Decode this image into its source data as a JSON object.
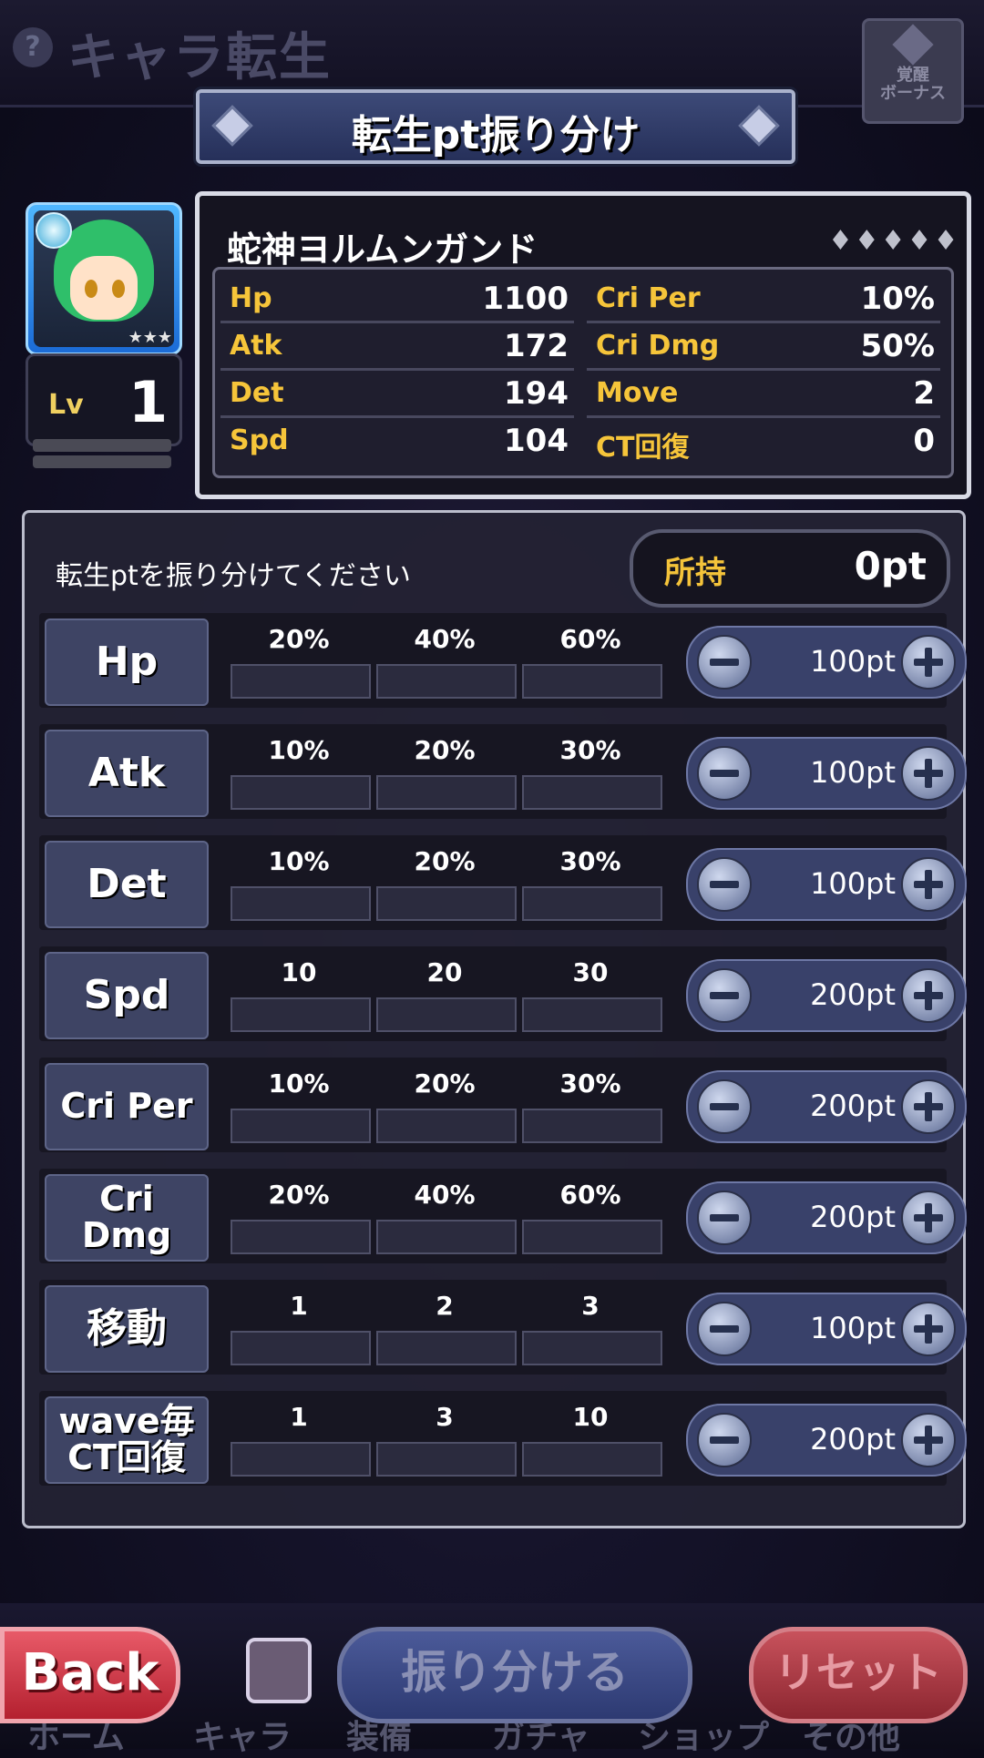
{
  "header": {
    "title": "キャラ転生",
    "help": "?",
    "awaken_button": "覚醒\nボーナス"
  },
  "ribbon": {
    "title": "転生pt振り分け"
  },
  "character": {
    "name": "蛇神ヨルムンガンド",
    "rarity": "♦♦♦♦♦",
    "level_label": "Lv",
    "level": "1",
    "stars": "★★★"
  },
  "stats": [
    {
      "label": "Hp",
      "value": "1100"
    },
    {
      "label": "Cri Per",
      "value": "10%"
    },
    {
      "label": "Atk",
      "value": "172"
    },
    {
      "label": "Cri Dmg",
      "value": "50%"
    },
    {
      "label": "Det",
      "value": "194"
    },
    {
      "label": "Move",
      "value": "2"
    },
    {
      "label": "Spd",
      "value": "104"
    },
    {
      "label": "CT回復",
      "value": "0"
    }
  ],
  "allocation": {
    "instruction": "転生ptを振り分けてください",
    "owned_label": "所持",
    "owned_value": "0pt",
    "rows": [
      {
        "label": "Hp",
        "tiers": [
          "20%",
          "40%",
          "60%"
        ],
        "cost": "100pt"
      },
      {
        "label": "Atk",
        "tiers": [
          "10%",
          "20%",
          "30%"
        ],
        "cost": "100pt"
      },
      {
        "label": "Det",
        "tiers": [
          "10%",
          "20%",
          "30%"
        ],
        "cost": "100pt"
      },
      {
        "label": "Spd",
        "tiers": [
          "10",
          "20",
          "30"
        ],
        "cost": "200pt"
      },
      {
        "label": "Cri Per",
        "tiers": [
          "10%",
          "20%",
          "30%"
        ],
        "cost": "200pt"
      },
      {
        "label": "Cri\nDmg",
        "tiers": [
          "20%",
          "40%",
          "60%"
        ],
        "cost": "200pt"
      },
      {
        "label": "移動",
        "tiers": [
          "1",
          "2",
          "3"
        ],
        "cost": "100pt"
      },
      {
        "label": "wave毎\nCT回復",
        "tiers": [
          "1",
          "3",
          "10"
        ],
        "cost": "200pt"
      }
    ]
  },
  "bottom": {
    "back": "Back",
    "assign": "振り分ける",
    "reset": "リセット",
    "tabs": [
      "ホーム",
      "キャラ",
      "装備",
      "ガチャ",
      "ショップ",
      "その他"
    ]
  },
  "colors": {
    "accent_gold": "#f6c53a",
    "back_red": "#c8303f",
    "panel_blue": "#3e4464"
  }
}
